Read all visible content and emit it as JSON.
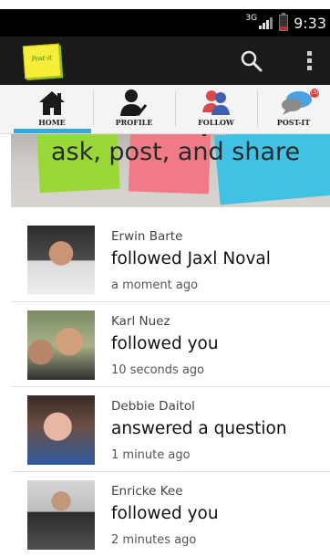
{
  "status_bar": {
    "network": "3G",
    "time": "9:33"
  },
  "app": {
    "logo_text": "Post-it"
  },
  "tabs": [
    {
      "label": "HOME",
      "badge": ""
    },
    {
      "label": "PROFILE",
      "badge": ""
    },
    {
      "label": "FOLLOW",
      "badge": ""
    },
    {
      "label": "POST-IT",
      "badge": "(3)"
    }
  ],
  "banner": {
    "text": "ask, post, and share"
  },
  "feed": [
    {
      "name": "Erwin Barte",
      "action": "followed Jaxl Noval",
      "time": "a moment ago"
    },
    {
      "name": "Karl Nuez",
      "action": "followed you",
      "time": "10 seconds ago"
    },
    {
      "name": "Debbie Daitol",
      "action": "answered a question",
      "time": "1 minute ago"
    },
    {
      "name": "Enricke Kee",
      "action": "followed you",
      "time": "2 minutes ago"
    }
  ],
  "colors": {
    "accent": "#33a9e0",
    "actionbar": "#1b1b1b",
    "status": "#000000"
  },
  "icons": [
    "search-icon",
    "overflow-menu-icon",
    "home-icon",
    "profile-icon",
    "follow-icon",
    "post-it-icon"
  ]
}
